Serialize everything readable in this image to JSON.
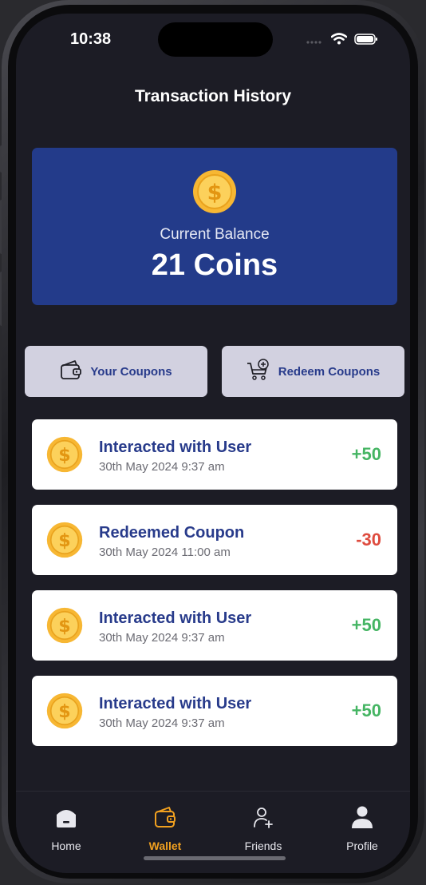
{
  "status_bar": {
    "time": "10:38",
    "icons": [
      "cellular-icon",
      "wifi-icon",
      "battery-icon"
    ]
  },
  "header": {
    "title": "Transaction History"
  },
  "balance": {
    "label": "Current Balance",
    "value": "21 Coins",
    "icon": "coin-icon",
    "card_color": "#233b8a"
  },
  "actions": {
    "your_coupons": {
      "label": "Your Coupons",
      "icon": "wallet-icon"
    },
    "redeem_coupons": {
      "label": "Redeem Coupons",
      "icon": "cart-add-icon"
    }
  },
  "transactions": [
    {
      "title": "Interacted with User",
      "date": "30th May 2024 9:37 am",
      "amount": "+50",
      "type": "credit"
    },
    {
      "title": "Redeemed Coupon",
      "date": "30th May 2024 11:00 am",
      "amount": "-30",
      "type": "debit"
    },
    {
      "title": "Interacted with User",
      "date": "30th May 2024 9:37 am",
      "amount": "+50",
      "type": "credit"
    },
    {
      "title": "Interacted with User",
      "date": "30th May 2024 9:37 am",
      "amount": "+50",
      "type": "credit"
    }
  ],
  "colors": {
    "credit": "#45b563",
    "debit": "#de4b3e",
    "accent": "#f0a020",
    "background": "#1c1c25"
  },
  "tabbar": {
    "items": [
      {
        "label": "Home",
        "icon": "home-icon",
        "active": false
      },
      {
        "label": "Wallet",
        "icon": "wallet-icon",
        "active": true
      },
      {
        "label": "Friends",
        "icon": "friends-icon",
        "active": false
      },
      {
        "label": "Profile",
        "icon": "profile-icon",
        "active": false
      }
    ]
  }
}
